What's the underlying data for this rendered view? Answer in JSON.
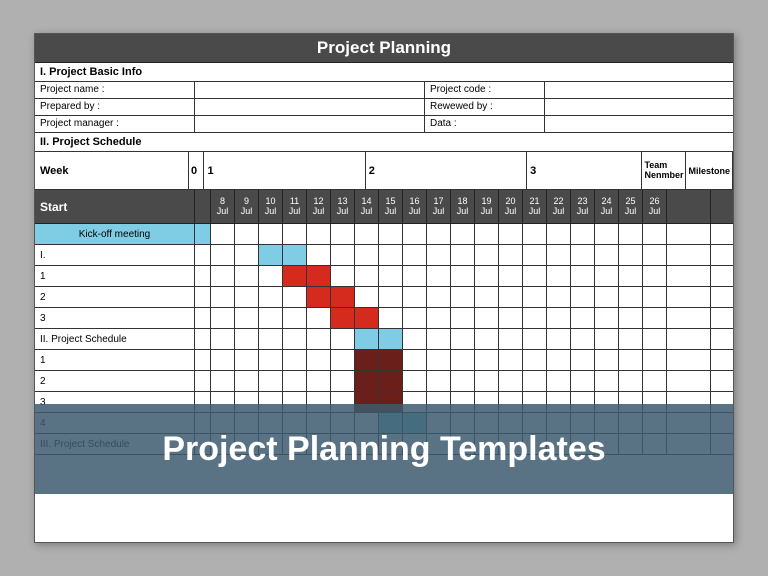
{
  "title": "Project Planning",
  "sections": {
    "basic_info": "I. Project Basic Info",
    "schedule": "II. Project Schedule",
    "schedule2": "II. Project Schedule",
    "schedule3": "III. Project Schedule"
  },
  "info": {
    "project_name_label": "Project name :",
    "project_code_label": "Project code :",
    "prepared_by_label": "Prepared by :",
    "reviewed_by_label": "Rewewed by :",
    "project_manager_label": "Project manager :",
    "data_label": "Data :"
  },
  "week": {
    "label": "Week",
    "w0": "0",
    "w1": "1",
    "w2": "2",
    "w3": "3",
    "team": "Team Nenmber",
    "milestone": "Milestone"
  },
  "start_label": "Start",
  "dates": [
    {
      "d": "8",
      "m": "Jul"
    },
    {
      "d": "9",
      "m": "Jul"
    },
    {
      "d": "10",
      "m": "Jul"
    },
    {
      "d": "11",
      "m": "Jul"
    },
    {
      "d": "12",
      "m": "Jul"
    },
    {
      "d": "13",
      "m": "Jul"
    },
    {
      "d": "14",
      "m": "Jul"
    },
    {
      "d": "15",
      "m": "Jul"
    },
    {
      "d": "16",
      "m": "Jul"
    },
    {
      "d": "17",
      "m": "Jul"
    },
    {
      "d": "18",
      "m": "Jul"
    },
    {
      "d": "19",
      "m": "Jul"
    },
    {
      "d": "20",
      "m": "Jul"
    },
    {
      "d": "21",
      "m": "Jul"
    },
    {
      "d": "22",
      "m": "Jul"
    },
    {
      "d": "23",
      "m": "Jul"
    },
    {
      "d": "24",
      "m": "Jul"
    },
    {
      "d": "25",
      "m": "Jul"
    },
    {
      "d": "26",
      "m": "Jul"
    }
  ],
  "rows": [
    {
      "label": "Kick-off meeting",
      "kickoff": true,
      "fills": {}
    },
    {
      "label": "I.",
      "fills": {
        "2": "blue",
        "3": "blue"
      }
    },
    {
      "label": "1",
      "fills": {
        "3": "red",
        "4": "red"
      }
    },
    {
      "label": "2",
      "fills": {
        "4": "red",
        "5": "red"
      }
    },
    {
      "label": "3",
      "fills": {
        "5": "red",
        "6": "red"
      }
    },
    {
      "label": "II. Project Schedule",
      "fills": {
        "6": "blue",
        "7": "blue"
      }
    },
    {
      "label": "1",
      "fills": {
        "6": "dred",
        "7": "dred"
      }
    },
    {
      "label": "2",
      "fills": {
        "6": "dred",
        "7": "dred"
      }
    },
    {
      "label": "3",
      "fills": {
        "6": "dred",
        "7": "dred"
      }
    },
    {
      "label": "4",
      "fills": {
        "7": "blue",
        "8": "blue"
      }
    },
    {
      "label": "III. Project Schedule",
      "fills": {}
    }
  ],
  "overlay_text": "Project Planning Templates",
  "chart_data": {
    "type": "table",
    "description": "Gantt-style project schedule",
    "date_axis": [
      "8 Jul",
      "9 Jul",
      "10 Jul",
      "11 Jul",
      "12 Jul",
      "13 Jul",
      "14 Jul",
      "15 Jul",
      "16 Jul",
      "17 Jul",
      "18 Jul",
      "19 Jul",
      "20 Jul",
      "21 Jul",
      "22 Jul",
      "23 Jul",
      "24 Jul",
      "25 Jul",
      "26 Jul"
    ],
    "tasks": [
      {
        "name": "Kick-off meeting",
        "start": null,
        "end": null,
        "color": "header-blue"
      },
      {
        "name": "I.",
        "start": "10 Jul",
        "end": "11 Jul",
        "color": "blue"
      },
      {
        "name": "1",
        "start": "11 Jul",
        "end": "12 Jul",
        "color": "red"
      },
      {
        "name": "2",
        "start": "12 Jul",
        "end": "13 Jul",
        "color": "red"
      },
      {
        "name": "3",
        "start": "13 Jul",
        "end": "14 Jul",
        "color": "red"
      },
      {
        "name": "II. Project Schedule",
        "start": "14 Jul",
        "end": "15 Jul",
        "color": "blue"
      },
      {
        "name": "1",
        "start": "14 Jul",
        "end": "15 Jul",
        "color": "dark-red"
      },
      {
        "name": "2",
        "start": "14 Jul",
        "end": "15 Jul",
        "color": "dark-red"
      },
      {
        "name": "3",
        "start": "14 Jul",
        "end": "15 Jul",
        "color": "dark-red"
      },
      {
        "name": "4",
        "start": "15 Jul",
        "end": "16 Jul",
        "color": "blue"
      },
      {
        "name": "III. Project Schedule",
        "start": null,
        "end": null
      }
    ]
  }
}
